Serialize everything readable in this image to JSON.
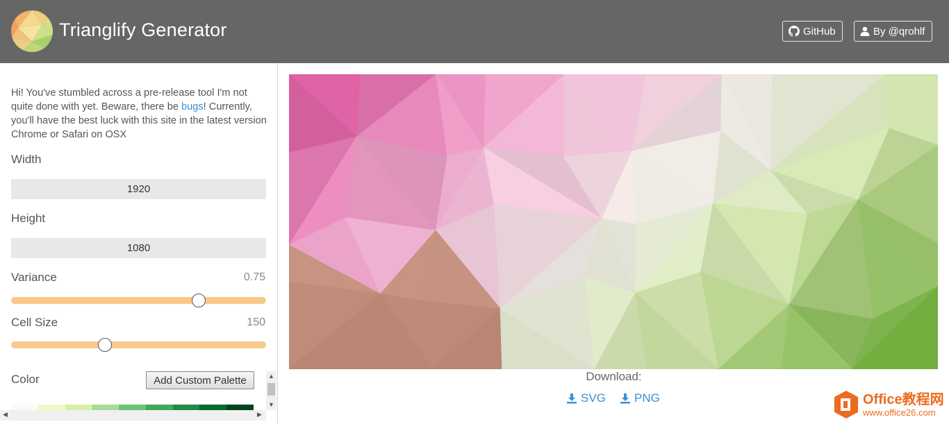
{
  "header": {
    "title": "Trianglify Generator",
    "github_label": "GitHub",
    "by_label": "By @qrohlf"
  },
  "sidebar": {
    "intro_part1": "Hi! You've stumbled across a pre-release tool I'm not quite done with yet. Beware, there be ",
    "intro_link": "bugs",
    "intro_part2": "! Currently, you'll have the best luck with this site in the latest version Chrome or Safari on OSX",
    "width_label": "Width",
    "width_value": "1920",
    "height_label": "Height",
    "height_value": "1080",
    "variance_label": "Variance",
    "variance_value": "0.75",
    "variance_fraction": 0.735,
    "cellsize_label": "Cell Size",
    "cellsize_value": "150",
    "cellsize_fraction": 0.369,
    "color_label": "Color",
    "custom_palette_label": "Add Custom Palette",
    "palette_colors": [
      "#f7fcf5",
      "#f0f9c4",
      "#d8efa8",
      "#a8dc94",
      "#6cc373",
      "#3fa85b",
      "#238a45",
      "#006b2e",
      "#00441b"
    ]
  },
  "main": {
    "download_label": "Download:",
    "svg_label": "SVG",
    "png_label": "PNG"
  },
  "watermark": {
    "title": "Office教程网",
    "url": "www.office26.com"
  },
  "colors": {
    "header_bg": "#666666",
    "slider": "#f9c98a",
    "link": "#3a8fd4",
    "watermark": "#ee6a1f"
  }
}
